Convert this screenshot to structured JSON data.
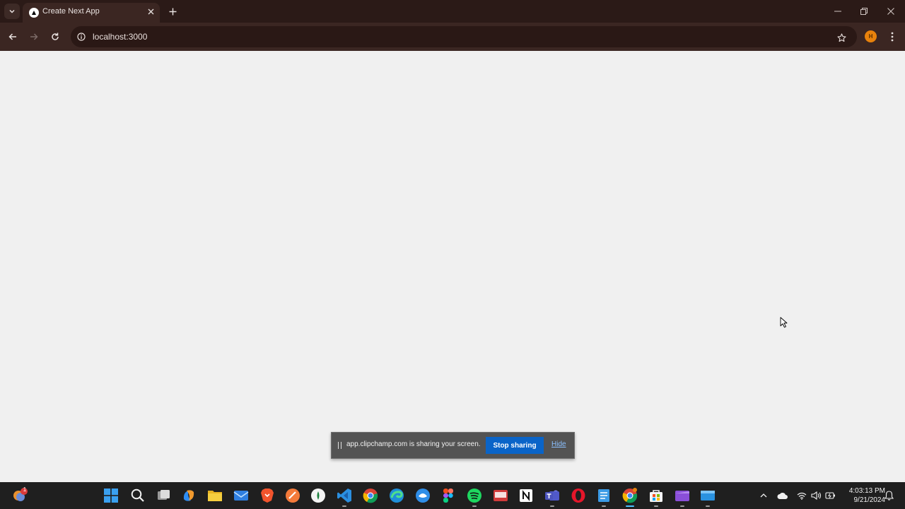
{
  "browser": {
    "tab_title": "Create Next App",
    "url": "localhost:3000",
    "profile_initial": "H"
  },
  "share_bar": {
    "message": "app.clipchamp.com is sharing your screen.",
    "stop_label": "Stop sharing",
    "hide_label": "Hide"
  },
  "taskbar": {
    "weather_badge": "1",
    "apps": [
      "start",
      "search",
      "task-view",
      "copilot",
      "file-explorer",
      "mail",
      "brave",
      "app-orange",
      "app-round",
      "vscode",
      "chrome",
      "edge",
      "app-blue",
      "figma",
      "spotify",
      "app-red",
      "notion",
      "teams",
      "opera",
      "notepad",
      "chrome-active",
      "store",
      "clipchamp",
      "app-window"
    ],
    "clock_time": "4:03:13 PM",
    "clock_date": "9/21/2024"
  },
  "colors": {
    "titlebar": "#2b1a17",
    "toolbar": "#3b2622",
    "page_bg": "#f0f0f0",
    "share_bar_bg": "#535353",
    "stop_button": "#0a64c8",
    "taskbar_bg": "#1f1f1f"
  }
}
